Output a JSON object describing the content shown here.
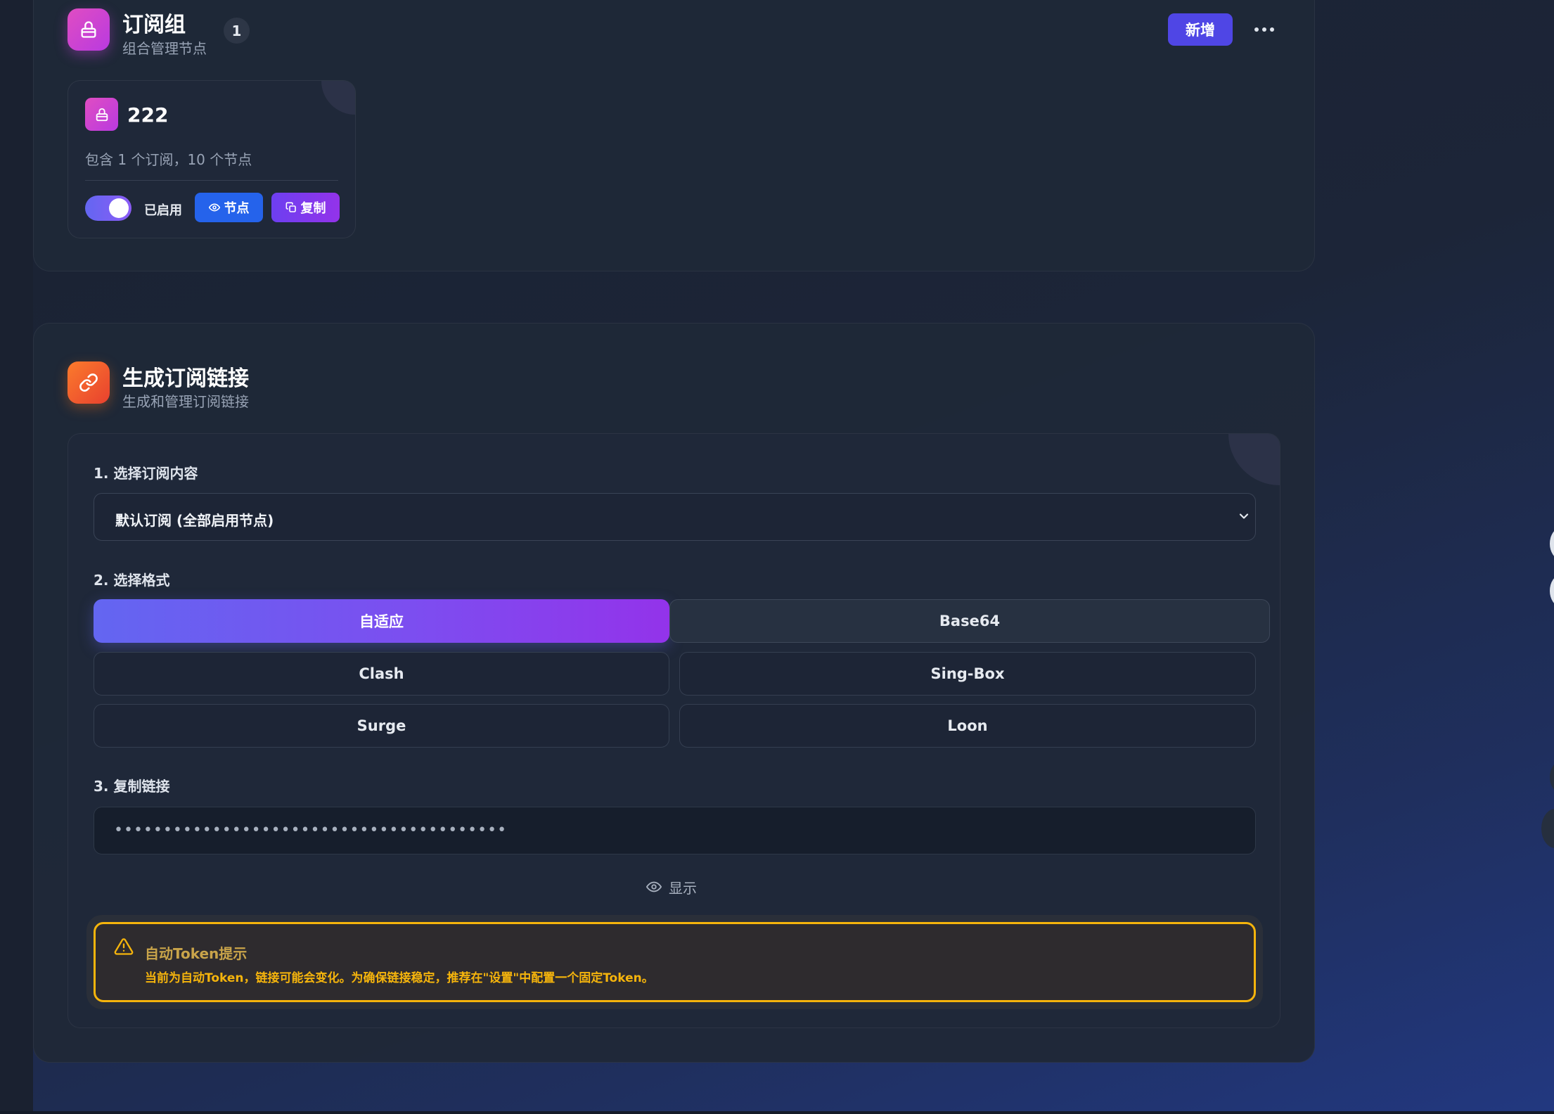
{
  "colors": {
    "accent": "#4f46e5",
    "gradient_start": "#6366f1",
    "gradient_end": "#9333ea",
    "warning": "#f5b40c",
    "node_button": "#2563eb"
  },
  "groups_section": {
    "title": "订阅组",
    "subtitle": "组合管理节点",
    "count": "1",
    "add_label": "新增",
    "icon": "lock-icon",
    "more_icon": "more-dots-icon",
    "groups": [
      {
        "name": "222",
        "description": "包含 1 个订阅，10 个节点",
        "enabled": true,
        "status_label": "已启用",
        "nodes_label": "节点",
        "copy_label": "复制"
      }
    ]
  },
  "link_section": {
    "title": "生成订阅链接",
    "subtitle": "生成和管理订阅链接",
    "icon": "link-icon",
    "step1_label": "1. 选择订阅内容",
    "selected_content": "默认订阅 (全部启用节点)",
    "step2_label": "2. 选择格式",
    "formats": [
      {
        "label": "自适应",
        "active": true
      },
      {
        "label": "Base64",
        "active": false
      },
      {
        "label": "Clash",
        "active": false
      },
      {
        "label": "Sing-Box",
        "active": false
      },
      {
        "label": "Surge",
        "active": false
      },
      {
        "label": "Loon",
        "active": false
      }
    ],
    "step3_label": "3. 复制链接",
    "masked_link": "••••••••••••••••••••••••••••••••••••••••",
    "show_label": "显示",
    "warning": {
      "title": "自动Token提示",
      "text": "当前为自动Token，链接可能会变化。为确保链接稳定，推荐在\"设置\"中配置一个固定Token。"
    }
  }
}
